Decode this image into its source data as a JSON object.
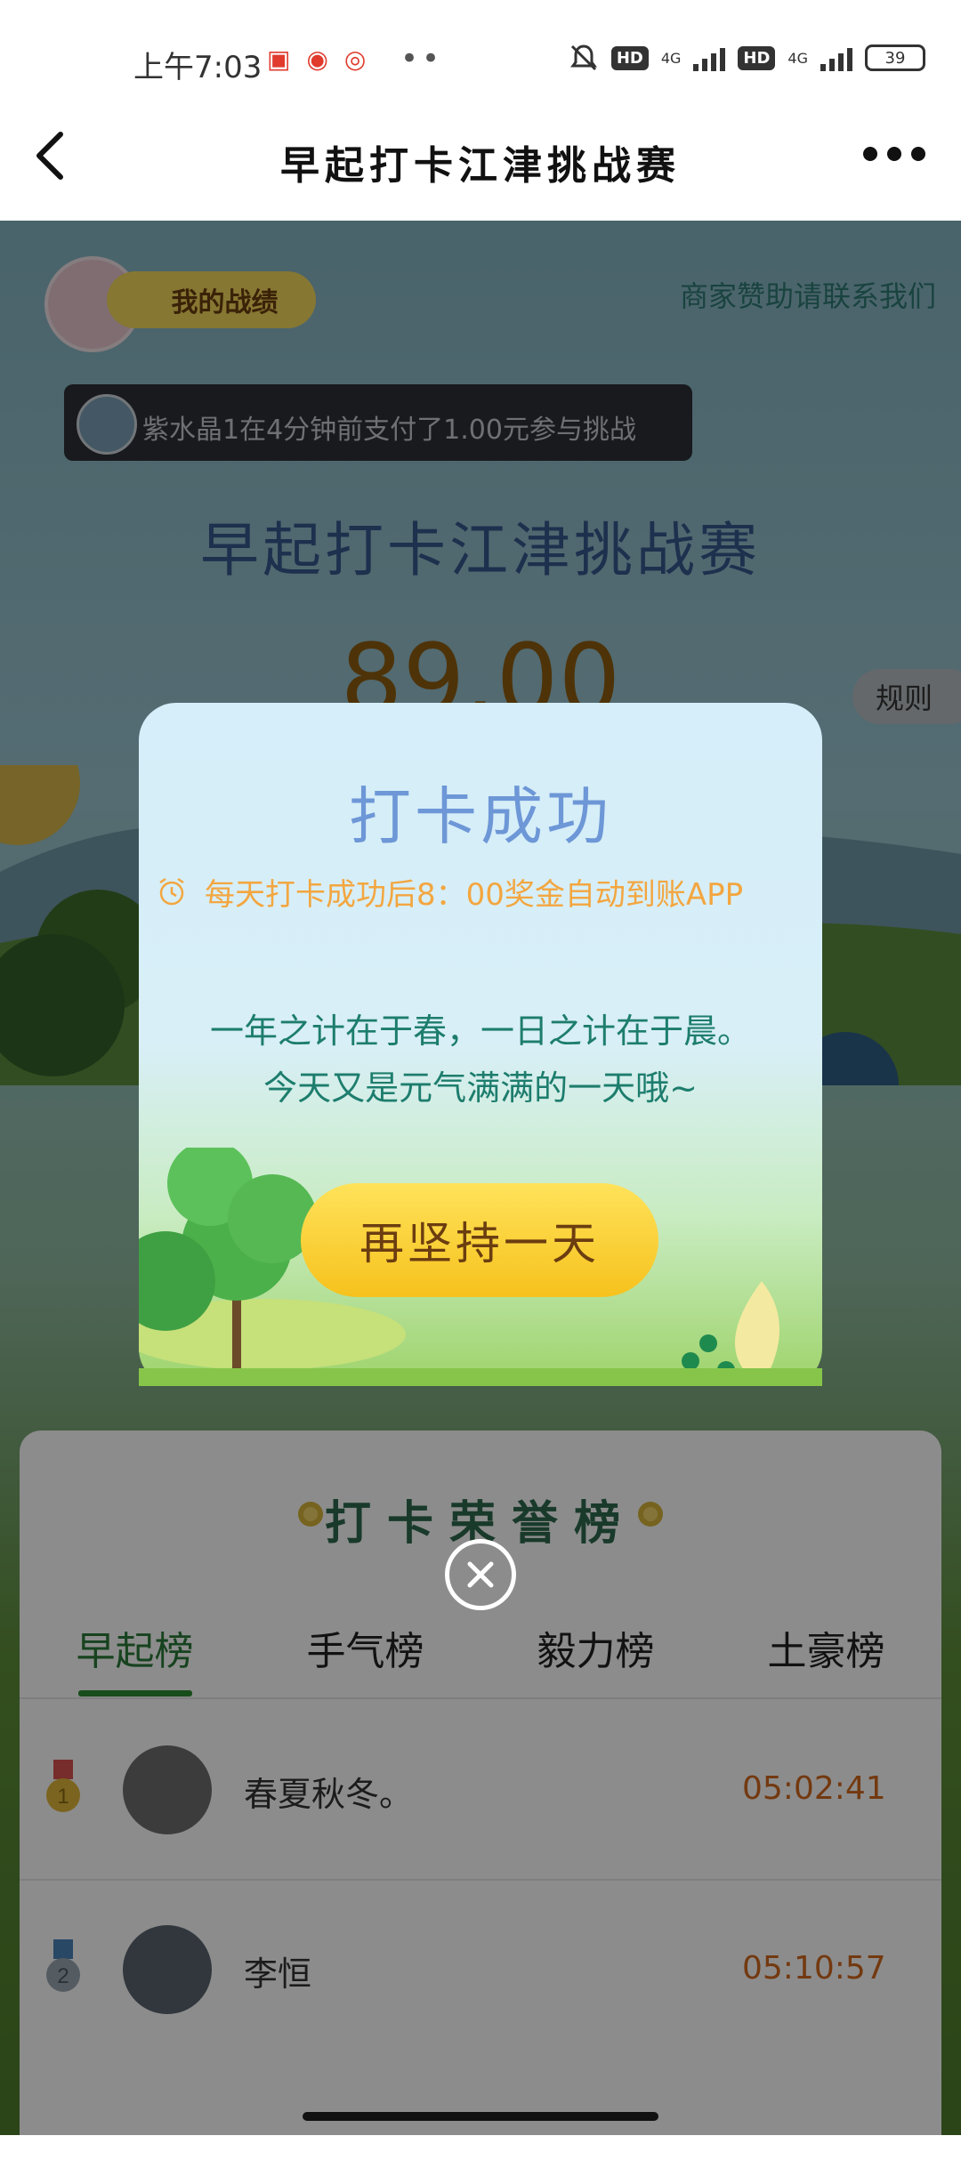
{
  "status_bar": {
    "time": "上午7:03",
    "battery": "39",
    "network_1": "4G",
    "network_2": "4G",
    "hd_badge": "HD"
  },
  "header": {
    "title": "早起打卡江津挑战赛",
    "back_icon": "chevron-left-icon",
    "more_icon": "more-horizontal-icon"
  },
  "main": {
    "my_record_label": "我的战绩",
    "sponsor_link": "商家赞助请联系我们",
    "ticker_text": "紫水晶1在4分钟前支付了1.00元参与挑战",
    "challenge_title": "早起打卡江津挑战赛",
    "prize_amount": "89.00",
    "rules_label": "规则"
  },
  "modal": {
    "title": "打卡成功",
    "tip": "每天打卡成功后8：00奖金自动到账APP",
    "quote_line1": "一年之计在于春，一日之计在于晨。",
    "quote_line2": "今天又是元气满满的一天哦~",
    "button_label": "再坚持一天",
    "close_icon": "close-circle-icon"
  },
  "leaderboard": {
    "title": "打卡荣誉榜",
    "tabs": [
      {
        "label": "早起榜",
        "active": true
      },
      {
        "label": "手气榜",
        "active": false
      },
      {
        "label": "毅力榜",
        "active": false
      },
      {
        "label": "土豪榜",
        "active": false
      }
    ],
    "rows": [
      {
        "rank": "1",
        "name": "春夏秋冬。",
        "time": "05:02:41"
      },
      {
        "rank": "2",
        "name": "李恒",
        "time": "05:10:57"
      }
    ]
  },
  "colors": {
    "modal_title": "#6d97d6",
    "tip": "#f3a640",
    "quote": "#1d7d6d",
    "button": "#f6c21d",
    "time_text": "#d2691e",
    "tab_active": "#2a7a3a"
  }
}
